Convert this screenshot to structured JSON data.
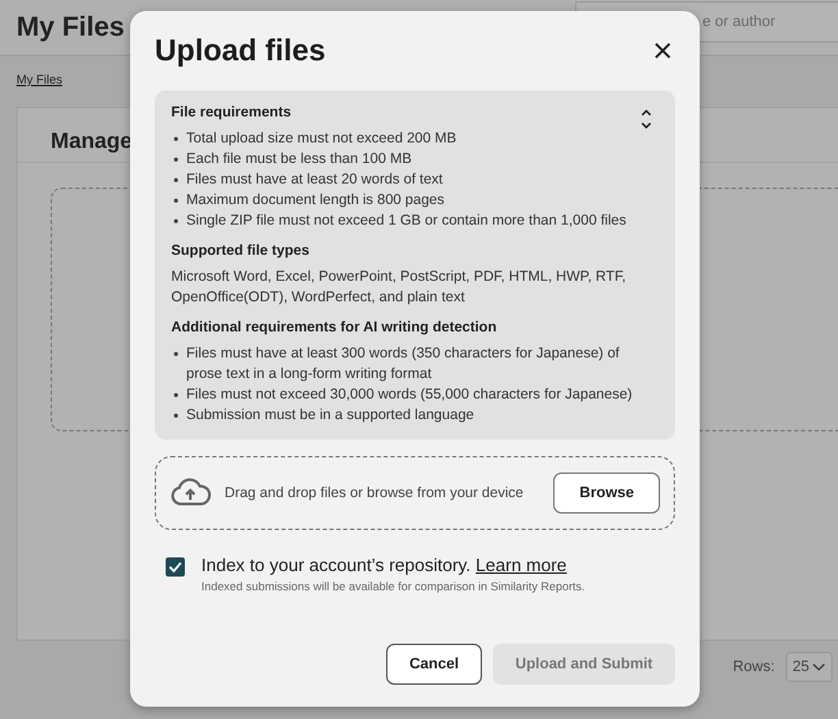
{
  "page": {
    "title": "My Files",
    "search": {
      "placeholder": "e or author"
    },
    "breadcrumb": "My Files",
    "card_title": "Manage",
    "rows_label": "Rows:",
    "rows_value": "25"
  },
  "dialog": {
    "title": "Upload files",
    "requirements": {
      "expanded": true,
      "heading": "File requirements",
      "items": [
        "Total upload size must not exceed 200 MB",
        "Each file must be less than 100 MB",
        "Files must have at least 20 words of text",
        "Maximum document length is 800 pages",
        "Single ZIP file must not exceed 1 GB or contain more than 1,000 files"
      ],
      "types_heading": "Supported file types",
      "types_text": "Microsoft Word, Excel, PowerPoint, PostScript, PDF, HTML, HWP, RTF, OpenOffice(ODT), WordPerfect, and plain text",
      "ai_heading": "Additional requirements for AI writing detection",
      "ai_items": [
        "Files must have at least 300 words (350 characters for Japanese) of prose text in a long-form writing format",
        "Files must not exceed 30,000 words (55,000 characters for Japanese)",
        "Submission must be in a supported language"
      ]
    },
    "dropzone": {
      "text": "Drag and drop files or browse from your device",
      "button": "Browse"
    },
    "index": {
      "checked": true,
      "label": "Index to your account’s repository.",
      "link": "Learn more",
      "hint": "Indexed submissions will be available for comparison in Similarity Reports."
    },
    "buttons": [
      {
        "label": "Cancel",
        "disabled": false
      },
      {
        "label": "Upload and Submit",
        "disabled": true
      }
    ]
  }
}
